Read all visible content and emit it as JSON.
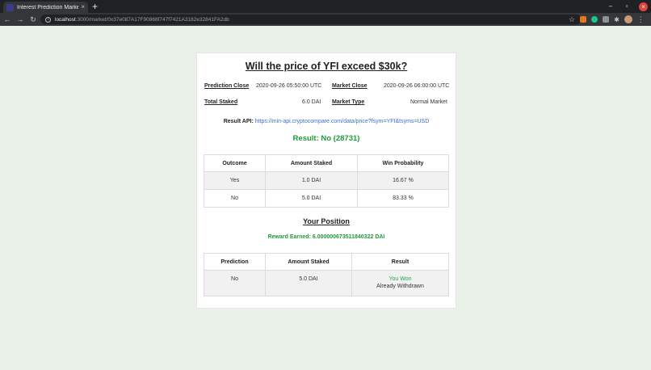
{
  "browser": {
    "tab_title": "Interest Prediction Market",
    "url_host": "localhost",
    "url_path": ":3000/market/0x37e087A17F90868f747f7421A3182e32841FA2db",
    "new_tab_label": "+",
    "close_label": "×"
  },
  "market": {
    "title": "Will the price of YFI exceed $30k?",
    "prediction_close_label": "Prediction Close",
    "prediction_close_value": "2020-09-26 05:50:00 UTC",
    "market_close_label": "Market Close",
    "market_close_value": "2020-09-26 06:00:00 UTC",
    "total_staked_label": "Total Staked",
    "total_staked_value": "6.0 DAI",
    "market_type_label": "Market Type",
    "market_type_value": "Normal Market",
    "result_api_label": "Result API:",
    "result_api_url": "https://min-api.cryptocompare.com/data/price?fsym=YFI&tsyms=USD",
    "result_text": "Result: No (28731)"
  },
  "outcomes_table": {
    "headers": [
      "Outcome",
      "Amount Staked",
      "Win Probability"
    ],
    "rows": [
      [
        "Yes",
        "1.0 DAI",
        "16.67 %"
      ],
      [
        "No",
        "5.0 DAI",
        "83.33 %"
      ]
    ]
  },
  "position": {
    "title": "Your Position",
    "reward_text": "Reward Earned: 6.000000673511840322 DAI",
    "headers": [
      "Prediction",
      "Amount Staked",
      "Result"
    ],
    "rows": [
      {
        "prediction": "No",
        "amount": "5.0 DAI",
        "result": "You Won",
        "status": "Already Withdrawn"
      }
    ]
  },
  "colors": {
    "page_bg": "#e9f1e9",
    "success": "#1e9b3b",
    "link": "#3b6fd1"
  }
}
